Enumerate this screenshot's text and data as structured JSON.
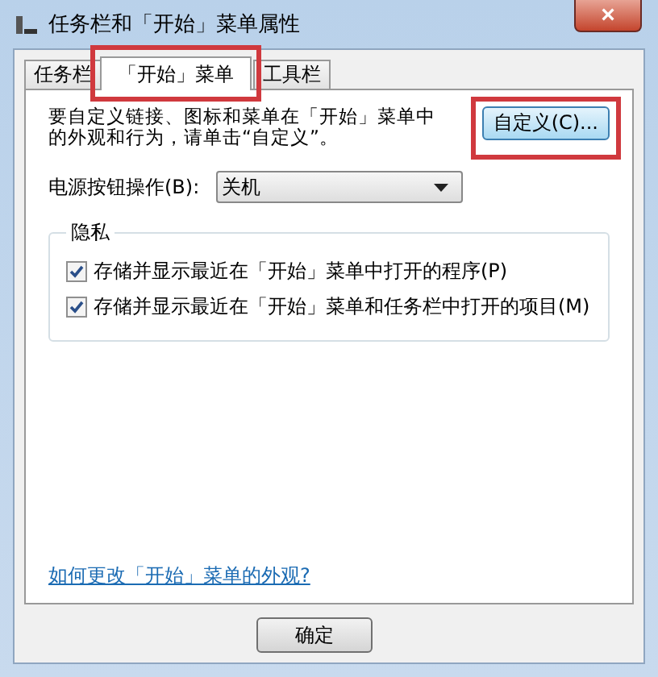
{
  "window": {
    "title": "任务栏和「开始」菜单属性",
    "close": "×"
  },
  "tabs": [
    {
      "label": "任务栏",
      "selected": false,
      "highlighted": false
    },
    {
      "label": "「开始」菜单",
      "selected": true,
      "highlighted": true
    },
    {
      "label": "工具栏",
      "selected": false,
      "highlighted": false
    }
  ],
  "intro": {
    "text": "要自定义链接、图标和菜单在「开始」菜单中的外观和行为，请单击“自定义”。",
    "button": "自定义(C)...",
    "button_highlighted": true
  },
  "power": {
    "label": "电源按钮操作(B):",
    "value": "关机"
  },
  "privacy": {
    "title": "隐私",
    "options": [
      {
        "label": "存储并显示最近在「开始」菜单中打开的程序(P)",
        "checked": true
      },
      {
        "label": "存储并显示最近在「开始」菜单和任务栏中打开的项目(M)",
        "checked": true
      }
    ]
  },
  "link": "如何更改「开始」菜单的外观?",
  "buttons": [
    "确定"
  ]
}
